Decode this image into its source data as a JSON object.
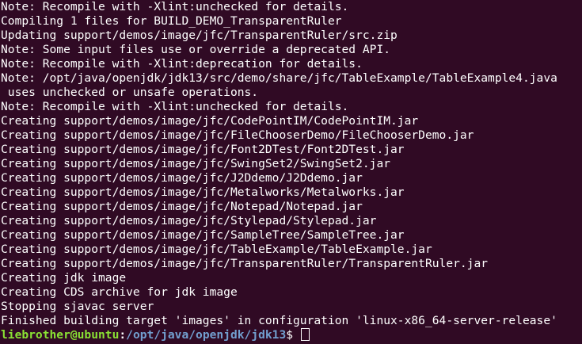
{
  "terminal": {
    "lines": [
      "Note: Recompile with -Xlint:unchecked for details.",
      "Compiling 1 files for BUILD_DEMO_TransparentRuler",
      "Updating support/demos/image/jfc/TransparentRuler/src.zip",
      "Note: Some input files use or override a deprecated API.",
      "Note: Recompile with -Xlint:deprecation for details.",
      "Note: /opt/java/openjdk/jdk13/src/demo/share/jfc/TableExample/TableExample4.java",
      " uses unchecked or unsafe operations.",
      "Note: Recompile with -Xlint:unchecked for details.",
      "Creating support/demos/image/jfc/CodePointIM/CodePointIM.jar",
      "Creating support/demos/image/jfc/FileChooserDemo/FileChooserDemo.jar",
      "Creating support/demos/image/jfc/Font2DTest/Font2DTest.jar",
      "Creating support/demos/image/jfc/SwingSet2/SwingSet2.jar",
      "Creating support/demos/image/jfc/J2Ddemo/J2Ddemo.jar",
      "Creating support/demos/image/jfc/Metalworks/Metalworks.jar",
      "Creating support/demos/image/jfc/Notepad/Notepad.jar",
      "Creating support/demos/image/jfc/Stylepad/Stylepad.jar",
      "Creating support/demos/image/jfc/SampleTree/SampleTree.jar",
      "Creating support/demos/image/jfc/TableExample/TableExample.jar",
      "Creating support/demos/image/jfc/TransparentRuler/TransparentRuler.jar",
      "Creating jdk image",
      "Creating CDS archive for jdk image",
      "Stopping sjavac server",
      "Finished building target 'images' in configuration 'linux-x86_64-server-release'"
    ],
    "prompt": {
      "user_host": "liebrother@ubuntu",
      "separator": ":",
      "path": "/opt/java/openjdk/jdk13",
      "dollar": "$ "
    },
    "colors": {
      "background": "#300a24",
      "text": "#ffffff",
      "user_host": "#8ae234",
      "path": "#729fcf"
    }
  }
}
